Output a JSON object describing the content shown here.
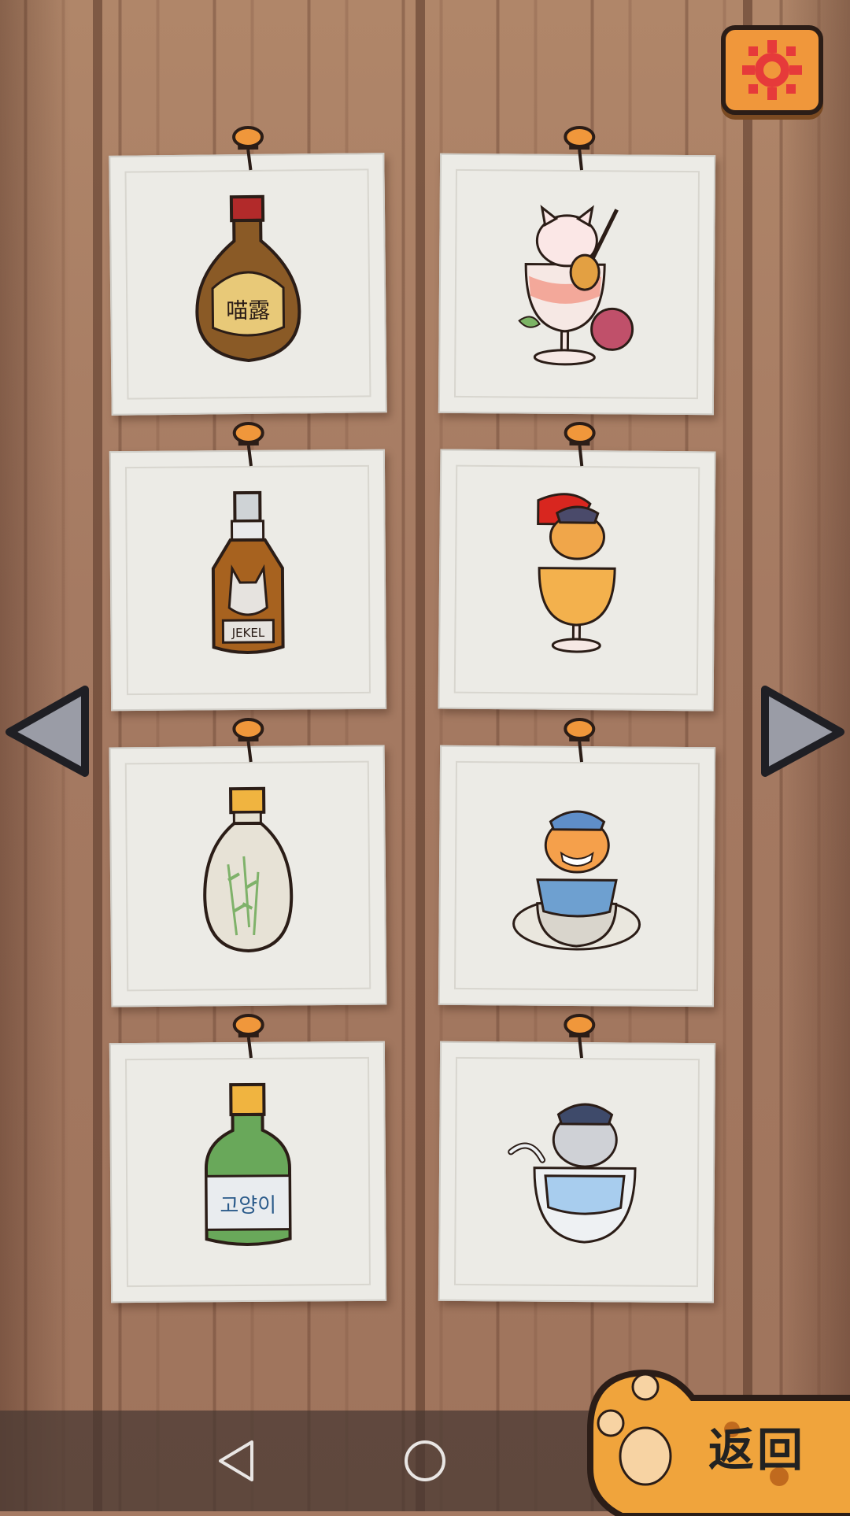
{
  "settings": {
    "icon": "gear-icon"
  },
  "cards": [
    {
      "name": "bottle-meow-dew",
      "label": "喵露",
      "type": "bottle"
    },
    {
      "name": "cat-guitar-rose-glass",
      "type": "cat"
    },
    {
      "name": "bottle-cat-whiskey",
      "label": "JEKEL",
      "type": "bottle"
    },
    {
      "name": "cat-hat-cocktail-glass",
      "type": "cat"
    },
    {
      "name": "bottle-bamboo-liquor",
      "type": "bottle"
    },
    {
      "name": "cat-teacup-cloud",
      "type": "cat"
    },
    {
      "name": "bottle-soju",
      "label": "고양이",
      "type": "bottle"
    },
    {
      "name": "cat-bowl-hat",
      "type": "cat"
    }
  ],
  "navigation": {
    "prev_icon": "left-arrow-icon",
    "next_icon": "right-arrow-icon"
  },
  "back": {
    "label": "返回",
    "icon": "paw-icon"
  },
  "system_nav": {
    "back_icon": "triangle-back-icon",
    "home_icon": "circle-home-icon",
    "recent_icon": "square-recent-icon"
  }
}
